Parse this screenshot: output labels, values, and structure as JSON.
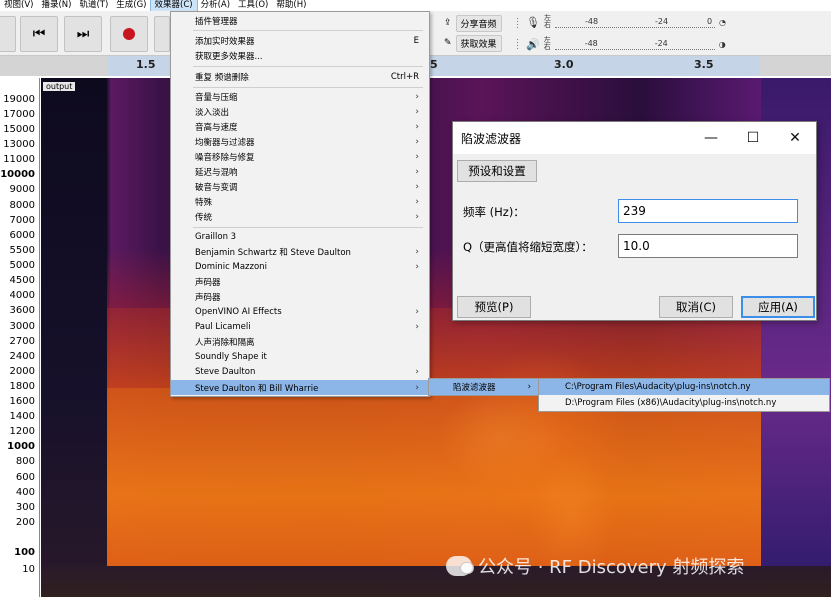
{
  "menubar": {
    "items": [
      {
        "label": "视图(V)"
      },
      {
        "label": "播录(N)"
      },
      {
        "label": "轨道(T)"
      },
      {
        "label": "生成(G)"
      },
      {
        "label": "效果器(C)"
      },
      {
        "label": "分析(A)"
      },
      {
        "label": "工具(O)"
      },
      {
        "label": "帮助(H)"
      }
    ]
  },
  "toolbar": {
    "share_audio": "分享音频",
    "get_effects": "获取效果",
    "meter_lr_top": "左",
    "meter_lr_bottom": "右",
    "meter_ticks": [
      "-48",
      "-24",
      "0"
    ]
  },
  "ruler": {
    "ticks": [
      "1.5",
      "5",
      "3.0",
      "3.5"
    ]
  },
  "track": {
    "name": "output",
    "y_labels": [
      "19000",
      "17000",
      "15000",
      "13000",
      "11000",
      "10000",
      "9000",
      "8000",
      "7000",
      "6000",
      "5500",
      "5000",
      "4500",
      "4000",
      "3600",
      "3000",
      "2700",
      "2400",
      "2000",
      "1800",
      "1600",
      "1400",
      "1200",
      "1000",
      "800",
      "600",
      "400",
      "300",
      "200",
      "100",
      "10"
    ]
  },
  "effects_menu": {
    "items": [
      {
        "label": "插件管理器",
        "shortcut": "",
        "arrow": ""
      },
      {
        "label": "添加实时效果器",
        "shortcut": "E",
        "arrow": ""
      },
      {
        "label": "获取更多效果器...",
        "shortcut": "",
        "arrow": ""
      },
      {
        "label": "重复 频谱删除",
        "shortcut": "Ctrl+R",
        "arrow": ""
      },
      {
        "label": "音量与压缩",
        "shortcut": "",
        "arrow": "›"
      },
      {
        "label": "淡入淡出",
        "shortcut": "",
        "arrow": "›"
      },
      {
        "label": "音高与速度",
        "shortcut": "",
        "arrow": "›"
      },
      {
        "label": "均衡器与过滤器",
        "shortcut": "",
        "arrow": "›"
      },
      {
        "label": "噪音移除与修复",
        "shortcut": "",
        "arrow": "›"
      },
      {
        "label": "延迟与混响",
        "shortcut": "",
        "arrow": "›"
      },
      {
        "label": "破音与变调",
        "shortcut": "",
        "arrow": "›"
      },
      {
        "label": "特殊",
        "shortcut": "",
        "arrow": "›"
      },
      {
        "label": "传统",
        "shortcut": "",
        "arrow": "›"
      },
      {
        "label": "Graillon 3",
        "shortcut": "",
        "arrow": ""
      },
      {
        "label": "Benjamin Schwartz 和 Steve Daulton",
        "shortcut": "",
        "arrow": "›"
      },
      {
        "label": "Dominic Mazzoni",
        "shortcut": "",
        "arrow": "›"
      },
      {
        "label": "声码器",
        "shortcut": "",
        "arrow": ""
      },
      {
        "label": "声码器",
        "shortcut": "",
        "arrow": ""
      },
      {
        "label": "OpenVINO AI Effects",
        "shortcut": "",
        "arrow": "›"
      },
      {
        "label": "Paul Licameli",
        "shortcut": "",
        "arrow": "›"
      },
      {
        "label": "人声消除和隔离",
        "shortcut": "",
        "arrow": ""
      },
      {
        "label": "Soundly Shape it",
        "shortcut": "",
        "arrow": ""
      },
      {
        "label": "Steve Daulton",
        "shortcut": "",
        "arrow": "›"
      },
      {
        "label": "Steve Daulton 和 Bill Wharrie",
        "shortcut": "",
        "arrow": "›"
      }
    ]
  },
  "submenu1": {
    "label": "陷波滤波器",
    "arrow": "›"
  },
  "submenu2": {
    "items": [
      {
        "label": "C:\\Program Files\\Audacity\\plug-ins\\notch.ny"
      },
      {
        "label": "D:\\Program Files (x86)\\Audacity\\plug-ins\\notch.ny"
      }
    ]
  },
  "dialog": {
    "title": "陷波滤波器",
    "minimize": "—",
    "maximize": "☐",
    "close": "✕",
    "preset_button": "预设和设置",
    "frequency_label": "频率 (Hz)：",
    "frequency_value": "239",
    "q_label": "Q（更高值将缩短宽度）：",
    "q_value": "10.0",
    "preview_button": "预览(P)",
    "cancel_button": "取消(C)",
    "apply_button": "应用(A)"
  },
  "watermark": {
    "text": "公众号 · RF Discovery 射频探索"
  }
}
